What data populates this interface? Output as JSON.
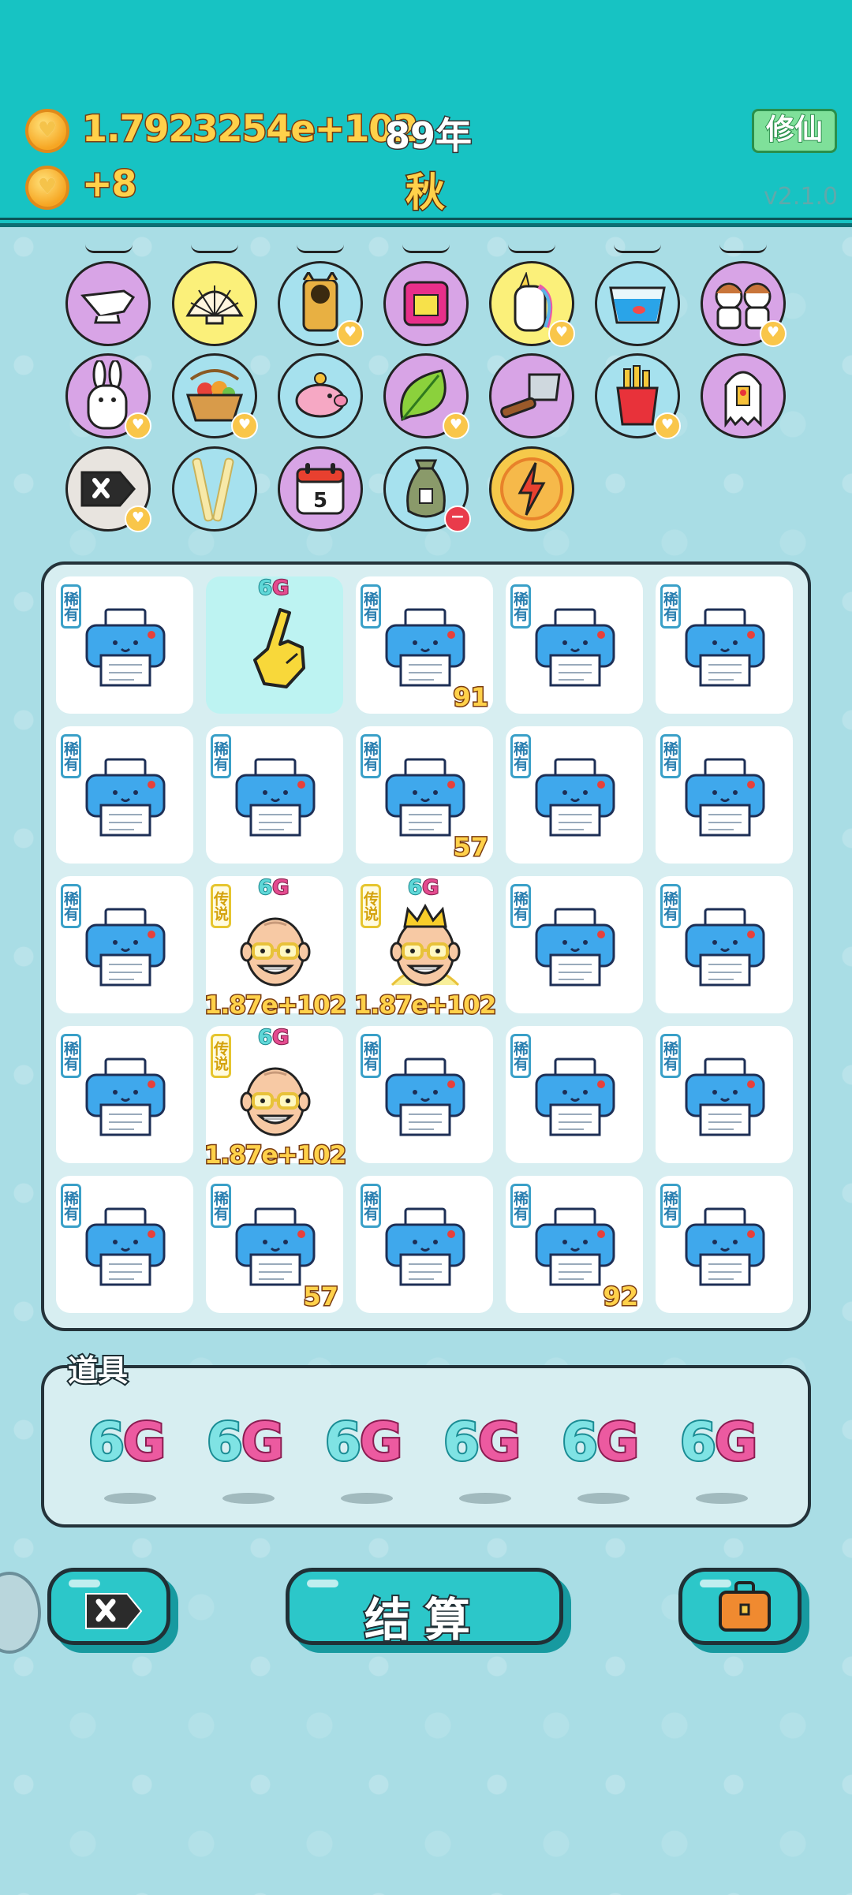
{
  "header": {
    "coins": "1.7923254e+102",
    "year": "89年",
    "income": "+8",
    "season": "秋",
    "xiuxian_label": "修仙",
    "version": "v2.1.0"
  },
  "items_row1": [
    "gravy-boat-icon",
    "shell-icon",
    "cat-icon",
    "sign-icon",
    "unicorn-icon",
    "fishbowl-icon",
    "twins-icon"
  ],
  "items_row2": [
    "bunny-icon",
    "fruit-basket-icon",
    "piggy-bank-icon",
    "leaf-icon",
    "cleaver-icon",
    "fries-icon",
    "ghost-icon"
  ],
  "items_row3": [
    "cancel-tag-icon",
    "sticks-icon",
    "calendar-icon",
    "money-bag-icon",
    "lightning-icon"
  ],
  "calendar_day": "5",
  "board": {
    "rarity_rare": "稀有",
    "rarity_legend": "传说",
    "tag_6": "6",
    "tag_g": "G",
    "cells": [
      {
        "num": ""
      },
      {
        "num": ""
      },
      {
        "num": "91"
      },
      {
        "num": ""
      },
      {
        "num": ""
      },
      {
        "num": ""
      },
      {
        "num": ""
      },
      {
        "num": "57"
      },
      {
        "num": ""
      },
      {
        "num": ""
      },
      {
        "num": ""
      },
      {
        "num": "1.87e+102"
      },
      {
        "num": "1.87e+102"
      },
      {
        "num": ""
      },
      {
        "num": ""
      },
      {
        "num": ""
      },
      {
        "num": "1.87e+102"
      },
      {
        "num": ""
      },
      {
        "num": ""
      },
      {
        "num": ""
      },
      {
        "num": ""
      },
      {
        "num": "57"
      },
      {
        "num": ""
      },
      {
        "num": "92"
      },
      {
        "num": ""
      }
    ]
  },
  "props": {
    "title": "道具",
    "items": [
      "6G",
      "6G",
      "6G",
      "6G",
      "6G",
      "6G"
    ]
  },
  "buttons": {
    "settle": "结算"
  },
  "colors": {
    "header": "#17c3c3",
    "background": "#a9dde5",
    "coin_text": "#ffd14a"
  }
}
